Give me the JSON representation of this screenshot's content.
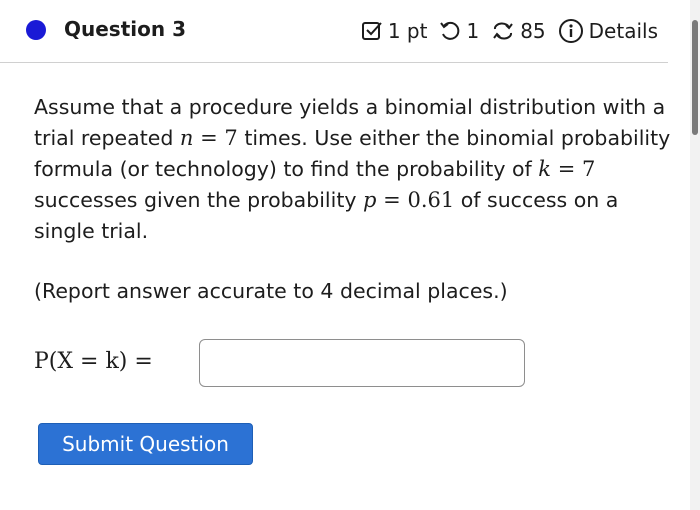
{
  "question": {
    "title": "Question 3",
    "points": "1 pt",
    "retries": "1",
    "submissions": "85",
    "details_label": "Details"
  },
  "problem": {
    "intro": "Assume that a procedure yields a binomial distribution with a trial repeated ",
    "n_var": "n",
    "eq": "=",
    "n_val": "7",
    "mid1": " times. Use either the binomial probability formula (or technology) to find the probability of ",
    "k_var": "k",
    "k_val": "7",
    "mid2": " successes given the probability ",
    "p_var": "p",
    "p_val": "0.61",
    "tail": " of success on a single trial."
  },
  "instructions": "(Report answer accurate to 4 decimal places.)",
  "answer": {
    "label": "P(X = k) =",
    "value": ""
  },
  "submit_label": "Submit Question",
  "colors": {
    "status_dot": "#1a1ad6",
    "button": "#2c72d4"
  }
}
